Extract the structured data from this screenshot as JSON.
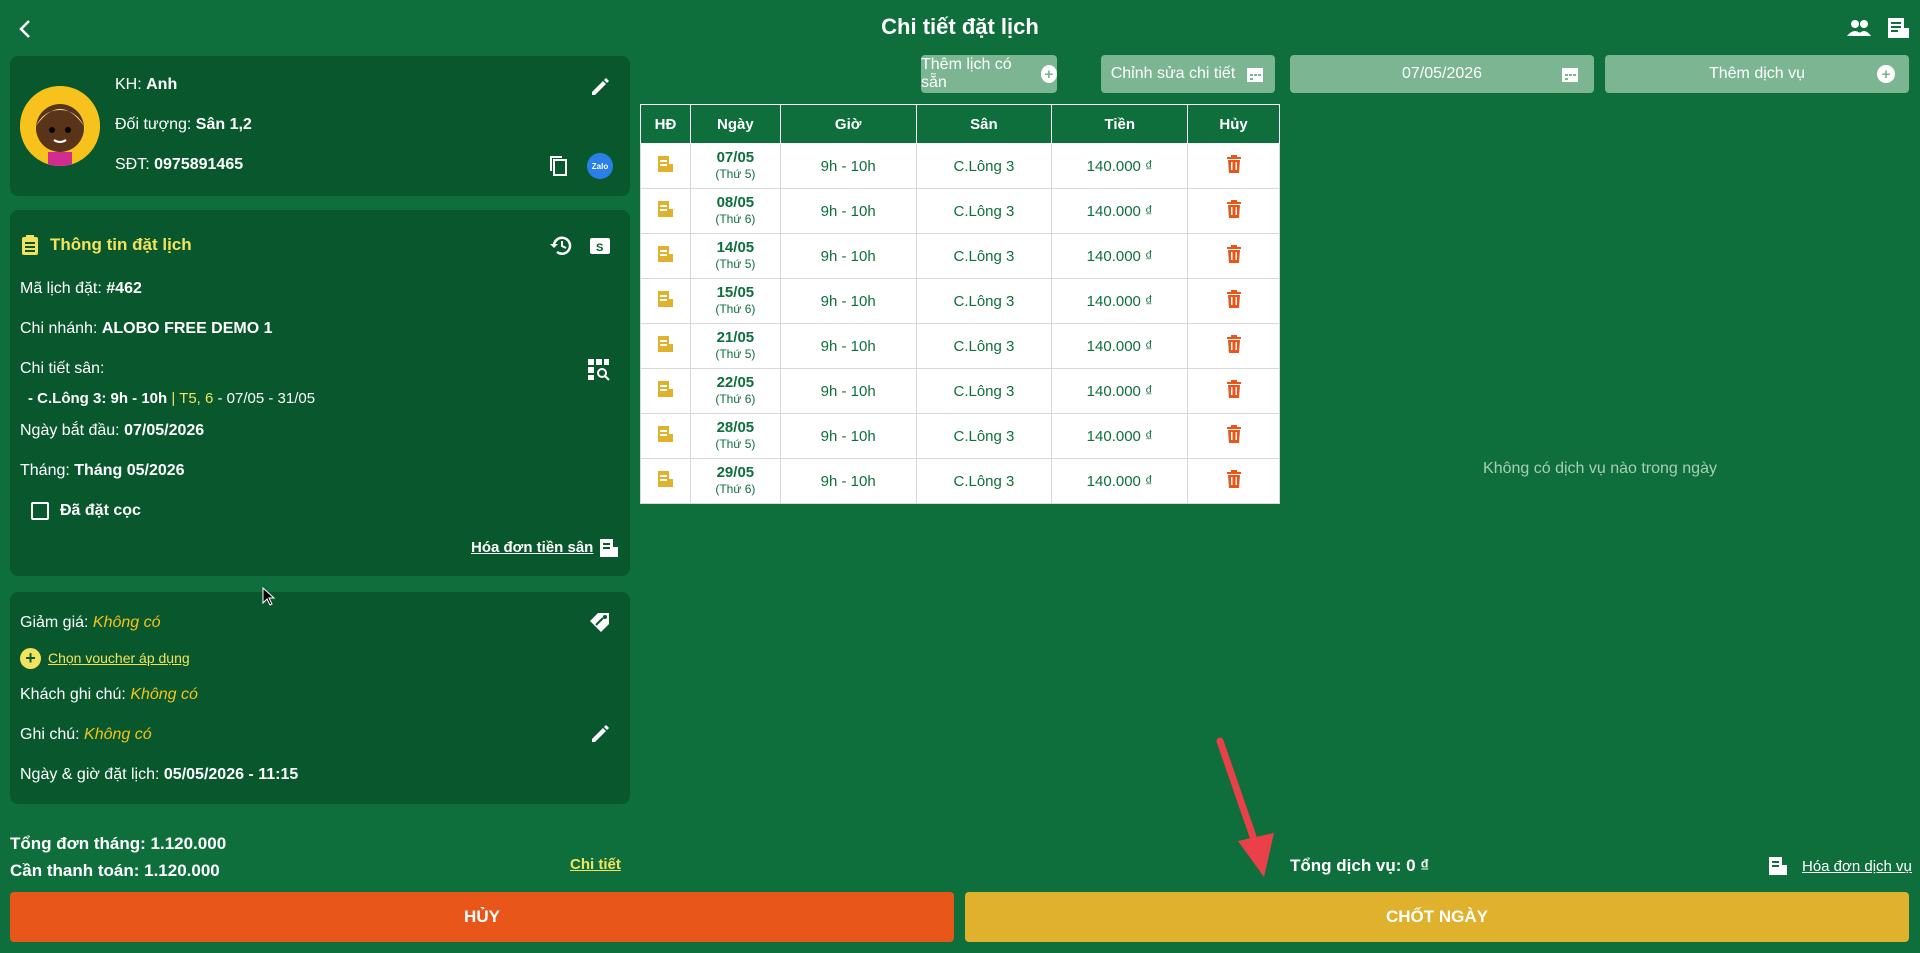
{
  "header": {
    "title": "Chi tiết đặt lịch"
  },
  "customer": {
    "name_label": "KH:",
    "name": "Anh",
    "target_label": "Đối tượng:",
    "target": "Sân 1,2",
    "phone_label": "SĐT:",
    "phone": "0975891465",
    "zalo_label": "Zalo"
  },
  "booking": {
    "title": "Thông tin đặt lịch",
    "code_label": "Mã lịch đặt:",
    "code": "#462",
    "branch_label": "Chi nhánh:",
    "branch": "ALOBO FREE DEMO 1",
    "court_detail_label": "Chi tiết sân:",
    "court_detail_line": "- C.Lông 3: 9h - 10h",
    "court_detail_sep": "|",
    "court_detail_days": "T5, 6",
    "court_detail_range": "- 07/05 - 31/05",
    "start_label": "Ngày bắt đầu:",
    "start": "07/05/2026",
    "month_label": "Tháng:",
    "month": "Tháng 05/2026",
    "deposit_label": "Đã đặt cọc",
    "invoice_link": "Hóa đơn tiền sân"
  },
  "extra": {
    "discount_label": "Giảm giá:",
    "discount": "Không có",
    "voucher_link": "Chọn voucher áp dụng",
    "customer_note_label": "Khách ghi chú:",
    "customer_note": "Không có",
    "note_label": "Ghi chú:",
    "note": "Không có",
    "booked_at_label": "Ngày & giờ đặt lịch:",
    "booked_at": "05/05/2026 - 11:15"
  },
  "totals": {
    "month_total_label": "Tổng đơn tháng:",
    "month_total": "1.120.000",
    "to_pay_label": "Cần thanh toán:",
    "to_pay": "1.120.000",
    "detail_link": "Chi tiết"
  },
  "toolbar": {
    "add_schedule": "Thêm lịch có sẵn",
    "edit_detail": "Chỉnh sửa chi tiết",
    "date": "07/05/2026",
    "add_service": "Thêm dịch vụ"
  },
  "table": {
    "headers": [
      "HĐ",
      "Ngày",
      "Giờ",
      "Sân",
      "Tiền",
      "Hủy"
    ],
    "rows": [
      {
        "date": "07/05",
        "weekday": "(Thứ 5)",
        "time": "9h - 10h",
        "court": "C.Lông 3",
        "price": "140.000 ₫"
      },
      {
        "date": "08/05",
        "weekday": "(Thứ 6)",
        "time": "9h - 10h",
        "court": "C.Lông 3",
        "price": "140.000 ₫"
      },
      {
        "date": "14/05",
        "weekday": "(Thứ 5)",
        "time": "9h - 10h",
        "court": "C.Lông 3",
        "price": "140.000 ₫"
      },
      {
        "date": "15/05",
        "weekday": "(Thứ 6)",
        "time": "9h - 10h",
        "court": "C.Lông 3",
        "price": "140.000 ₫"
      },
      {
        "date": "21/05",
        "weekday": "(Thứ 5)",
        "time": "9h - 10h",
        "court": "C.Lông 3",
        "price": "140.000 ₫"
      },
      {
        "date": "22/05",
        "weekday": "(Thứ 6)",
        "time": "9h - 10h",
        "court": "C.Lông 3",
        "price": "140.000 ₫"
      },
      {
        "date": "28/05",
        "weekday": "(Thứ 5)",
        "time": "9h - 10h",
        "court": "C.Lông 3",
        "price": "140.000 ₫"
      },
      {
        "date": "29/05",
        "weekday": "(Thứ 6)",
        "time": "9h - 10h",
        "court": "C.Lông 3",
        "price": "140.000 ₫"
      }
    ]
  },
  "services": {
    "empty": "Không có dịch vụ nào trong ngày",
    "total_label": "Tổng dịch vụ:",
    "total": "0 ₫",
    "invoice_link": "Hóa đơn dịch vụ"
  },
  "actions": {
    "cancel": "HỦY",
    "confirm": "CHỐT NGÀY"
  },
  "colors": {
    "bg": "#0e6f3c",
    "card": "#09582d",
    "cancel": "#e8561a",
    "confirm": "#e0b12c",
    "accent_yellow": "#f3c31b",
    "trash": "#e8561a"
  }
}
